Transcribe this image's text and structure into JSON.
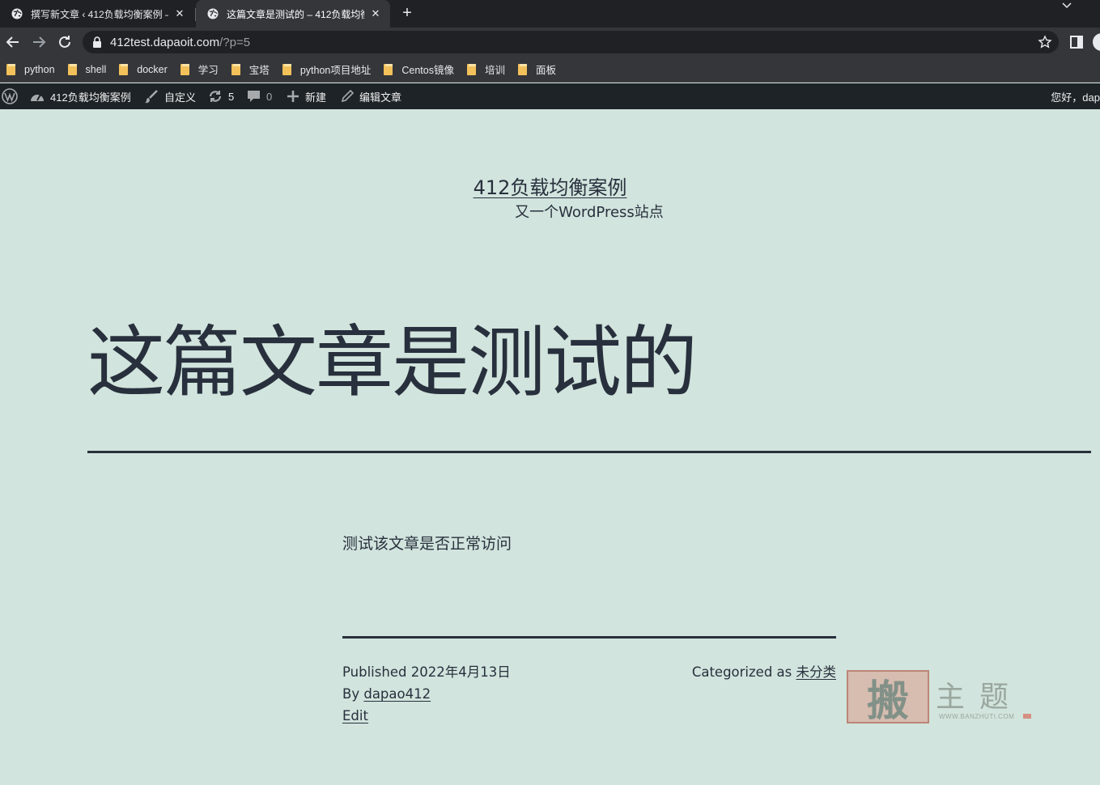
{
  "browser": {
    "tabs": [
      {
        "title": "撰写新文章 ‹ 412负载均衡案例 —",
        "active": false
      },
      {
        "title": "这篇文章是测试的 – 412负载均衡",
        "active": true
      }
    ],
    "url_host": "412test.dapaoit.com",
    "url_path": "/?p=5",
    "bookmarks": [
      "python",
      "shell",
      "docker",
      "学习",
      "宝塔",
      "python项目地址",
      "Centos镜像",
      "培训",
      "面板"
    ]
  },
  "adminbar": {
    "site_name": "412负载均衡案例",
    "customize": "自定义",
    "updates_count": "5",
    "comments_count": "0",
    "new_label": "新建",
    "edit_label": "编辑文章",
    "greeting": "您好，dap"
  },
  "site": {
    "title": "412负载均衡案例",
    "description": "又一个WordPress站点"
  },
  "post": {
    "title": "这篇文章是测试的",
    "content": "测试该文章是否正常访问",
    "published_label": "Published",
    "published_date": "2022年4月13日",
    "by_label": "By",
    "author": "dapao412",
    "edit_label": "Edit",
    "categorized_label": "Categorized as",
    "category": "未分类"
  },
  "watermark": {
    "seal_char": "搬",
    "text": "主题",
    "url": "WWW.BANZHUTI.COM"
  },
  "colors": {
    "page_bg": "#d1e4dd",
    "text": "#28303d",
    "adminbar_bg": "#1d2327",
    "chrome_dark": "#202124",
    "chrome_toolbar": "#35363a"
  }
}
